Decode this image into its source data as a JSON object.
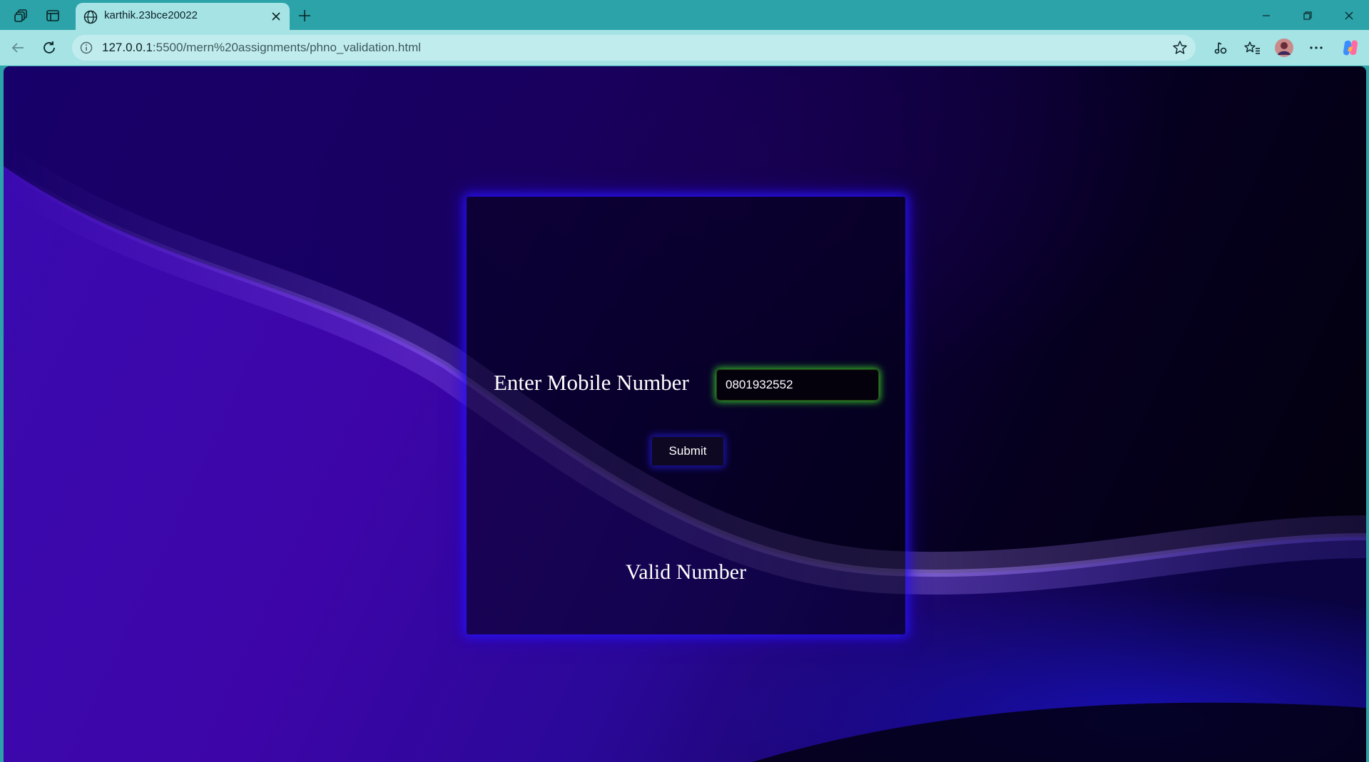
{
  "browser": {
    "tab_title": "karthik.23bce20022",
    "url_host": "127.0.0.1",
    "url_rest": ":5500/mern%20assignments/phno_validation.html"
  },
  "page": {
    "label": "Enter Mobile Number",
    "phone_value": "0801932552",
    "submit_label": "Submit",
    "result_text": "Valid Number"
  },
  "colors": {
    "chrome_teal": "#2ba3a9",
    "address_bar": "#a6e3e5",
    "card_glow": "#2814ff",
    "input_glow": "#3cdc28"
  },
  "icons": [
    "workspaces-icon",
    "tab-actions-icon",
    "globe-icon",
    "close-icon",
    "plus-icon",
    "minimize-icon",
    "restore-icon",
    "window-close-icon",
    "back-icon",
    "refresh-icon",
    "info-icon",
    "star-icon",
    "read-aloud-icon",
    "favorites-icon",
    "avatar",
    "more-icon",
    "copilot-icon"
  ]
}
